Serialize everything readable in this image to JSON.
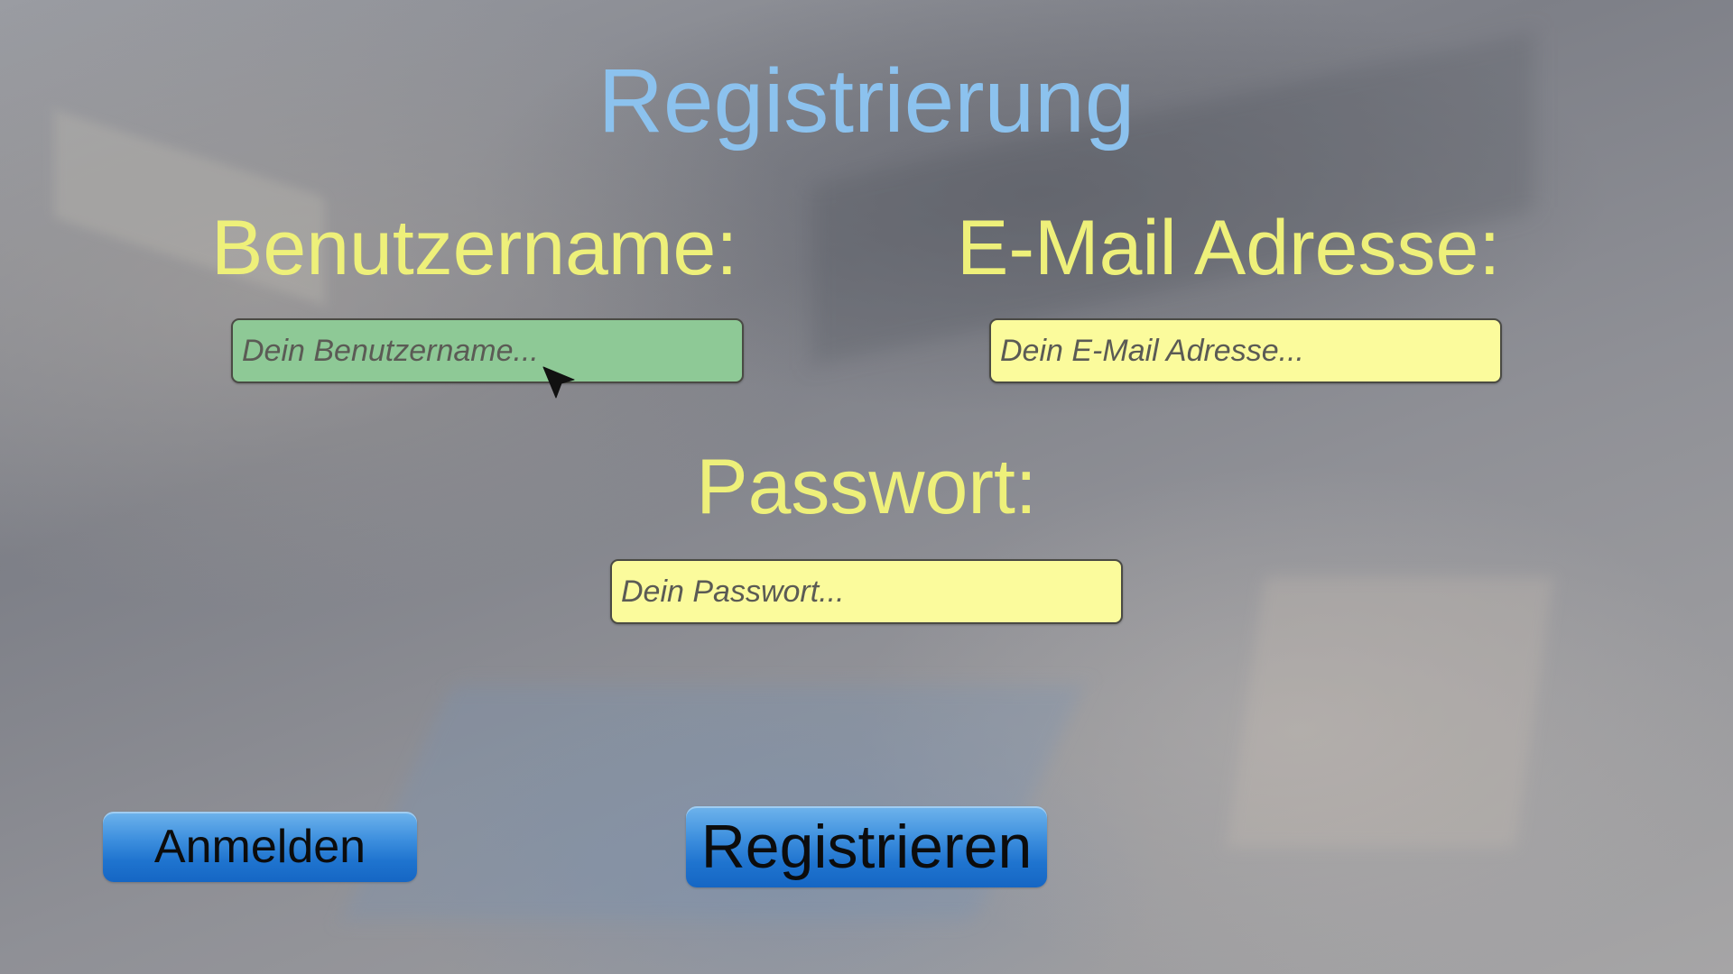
{
  "title": "Registrierung",
  "username": {
    "label": "Benutzername:",
    "placeholder": "Dein Benutzername...",
    "value": ""
  },
  "email": {
    "label": "E-Mail Adresse:",
    "placeholder": "Dein E-Mail Adresse...",
    "value": ""
  },
  "password": {
    "label": "Passwort:",
    "placeholder": "Dein Passwort...",
    "value": ""
  },
  "buttons": {
    "login_label": "Anmelden",
    "register_label": "Registrieren"
  },
  "colors": {
    "title": "#8cc2ee",
    "labels": "#eef07a",
    "field_focused": "#8ec996",
    "field_default": "#fbfb9c",
    "button_blue": "#1f74cf"
  },
  "cursor_icon": "mouse-pointer-icon"
}
